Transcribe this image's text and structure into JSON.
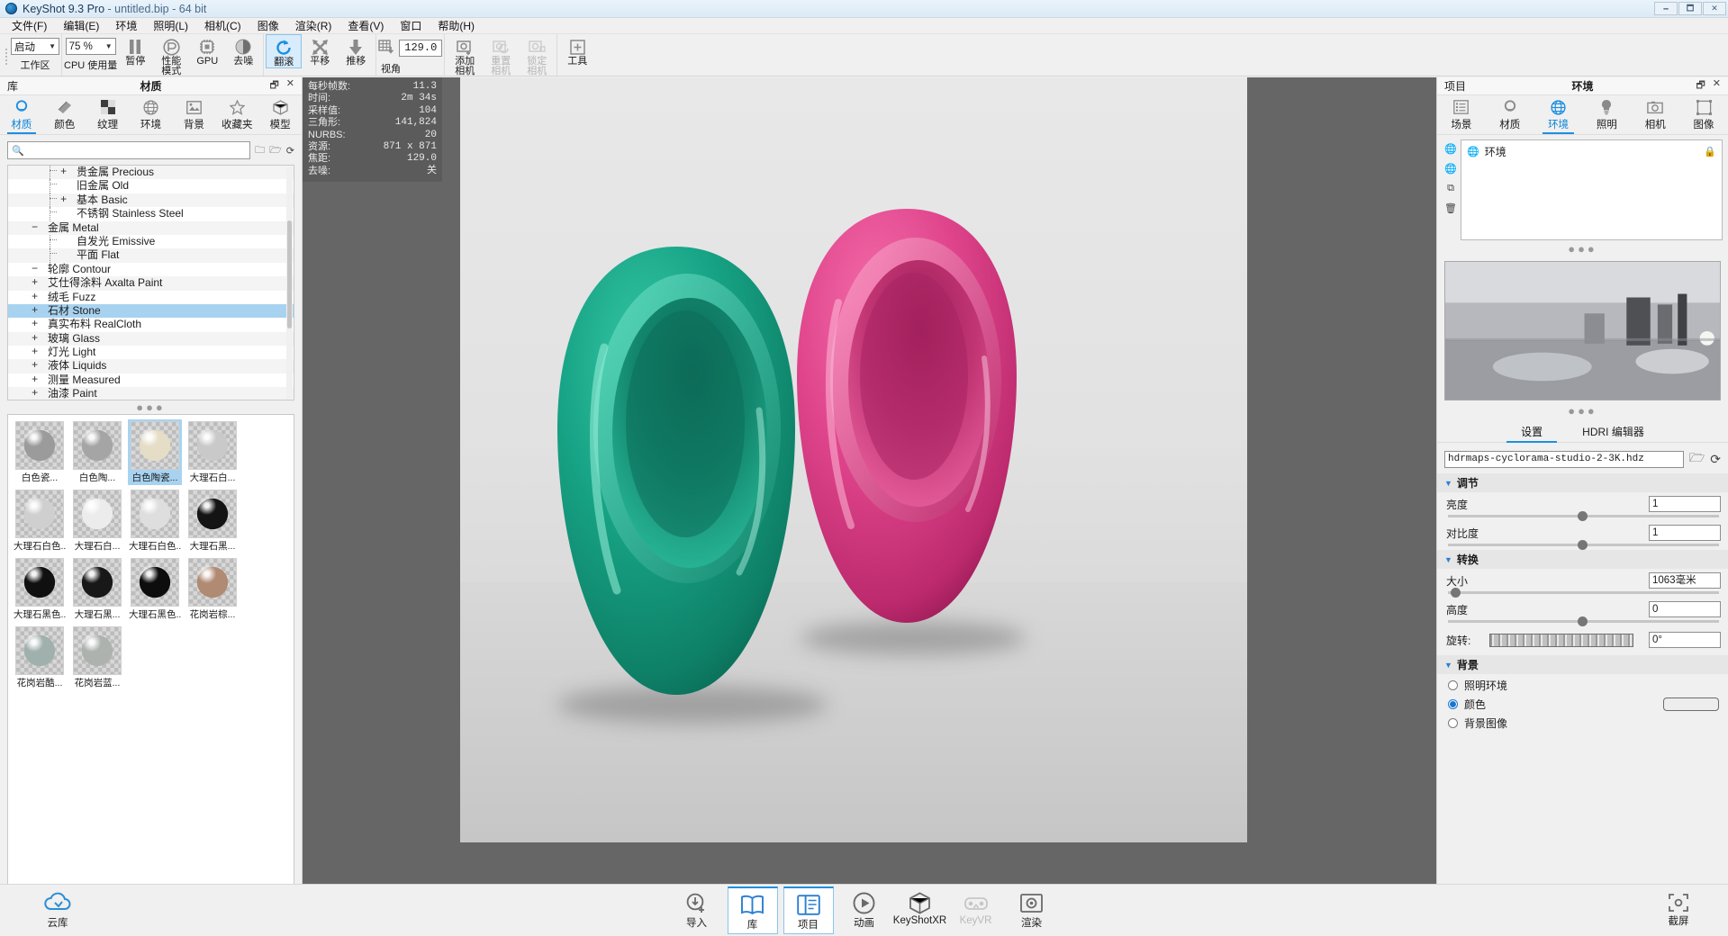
{
  "window": {
    "title_app": "KeyShot 9.3 Pro",
    "title_file": "- untitled.bip",
    "title_bits": "- 64 bit",
    "btn_minimize": "🗕",
    "btn_maximize": "🗖",
    "btn_close": "✕"
  },
  "menubar": {
    "items": [
      {
        "label": "文件(F)"
      },
      {
        "label": "编辑(E)"
      },
      {
        "label": "环境"
      },
      {
        "label": "照明(L)"
      },
      {
        "label": "相机(C)"
      },
      {
        "label": "图像"
      },
      {
        "label": "渲染(R)"
      },
      {
        "label": "查看(V)"
      },
      {
        "label": "窗口"
      },
      {
        "label": "帮助(H)"
      }
    ]
  },
  "toolbar": {
    "workspace_value": "启动",
    "workspace_label": "工作区",
    "cpu_value": "75 %",
    "cpu_label": "CPU 使用量",
    "pause_label": "暂停",
    "perf_label_1": "性能",
    "perf_label_2": "模式",
    "gpu_label": "GPU",
    "denoise_label": "去噪",
    "tumble_label": "翻滚",
    "pan_label": "平移",
    "dolly_label": "推移",
    "fov_value": "129.0",
    "fov_label": "视角",
    "addcam_label_1": "添加",
    "addcam_label_2": "相机",
    "resetcam_label_1": "重置",
    "resetcam_label_2": "相机",
    "lockcam_label_1": "锁定",
    "lockcam_label_2": "相机",
    "tools_label": "工具"
  },
  "library": {
    "panel_left_title": "库",
    "panel_center_title": "材质",
    "header_icons": {
      "float": "🗗",
      "close": "✕"
    },
    "tabs": [
      {
        "label": "材质",
        "icon": "material-icon",
        "active": true
      },
      {
        "label": "颜色",
        "icon": "color-icon",
        "active": false
      },
      {
        "label": "纹理",
        "icon": "texture-icon",
        "active": false
      },
      {
        "label": "环境",
        "icon": "environment-icon",
        "active": false
      },
      {
        "label": "背景",
        "icon": "background-icon",
        "active": false
      },
      {
        "label": "收藏夹",
        "icon": "star-icon",
        "active": false
      },
      {
        "label": "模型",
        "icon": "model-icon",
        "active": false
      }
    ],
    "search_placeholder": "",
    "search_value": "",
    "tree": [
      {
        "label": "油漆 Paint",
        "toggle": "+",
        "level": 1,
        "selected": false
      },
      {
        "label": "测量 Measured",
        "toggle": "+",
        "level": 1,
        "selected": false
      },
      {
        "label": "液体 Liquids",
        "toggle": "+",
        "level": 1,
        "selected": false
      },
      {
        "label": "灯光 Light",
        "toggle": "+",
        "level": 1,
        "selected": false
      },
      {
        "label": "玻璃 Glass",
        "toggle": "+",
        "level": 1,
        "selected": false
      },
      {
        "label": "真实布料 RealCloth",
        "toggle": "+",
        "level": 1,
        "selected": false
      },
      {
        "label": "石材 Stone",
        "toggle": "+",
        "level": 1,
        "selected": true
      },
      {
        "label": "绒毛 Fuzz",
        "toggle": "+",
        "level": 1,
        "selected": false
      },
      {
        "label": "艾仕得涂料 Axalta Paint",
        "toggle": "+",
        "level": 1,
        "selected": false
      },
      {
        "label": "轮廓 Contour",
        "toggle": "−",
        "level": 1,
        "selected": false
      },
      {
        "label": "平面 Flat",
        "toggle": "",
        "level": 2,
        "selected": false
      },
      {
        "label": "自发光 Emissive",
        "toggle": "",
        "level": 2,
        "selected": false
      },
      {
        "label": "金属 Metal",
        "toggle": "−",
        "level": 1,
        "selected": false
      },
      {
        "label": "不锈钢 Stainless Steel",
        "toggle": "",
        "level": 2,
        "selected": false
      },
      {
        "label": "基本 Basic",
        "toggle": "+",
        "level": 2,
        "selected": false
      },
      {
        "label": "旧金属 Old",
        "toggle": "",
        "level": 2,
        "selected": false
      },
      {
        "label": "贵金属 Precious",
        "toggle": "+",
        "level": 2,
        "selected": false
      }
    ],
    "materials": [
      {
        "caption": "白色瓷...",
        "color": "#9b9b9b",
        "selected": false
      },
      {
        "caption": "白色陶...",
        "color": "#a5a5a5",
        "selected": false
      },
      {
        "caption": "白色陶瓷...",
        "color": "#e6ddc7",
        "selected": true
      },
      {
        "caption": "大理石白...",
        "color": "#c9c9c9",
        "selected": false
      },
      {
        "caption": "大理石白色...",
        "color": "#cfcfcf",
        "selected": false
      },
      {
        "caption": "大理石白...",
        "color": "#ececec",
        "selected": false
      },
      {
        "caption": "大理石白色...",
        "color": "#dedede",
        "selected": false
      },
      {
        "caption": "大理石黑...",
        "color": "#141414",
        "selected": false
      },
      {
        "caption": "大理石黑色...",
        "color": "#101010",
        "selected": false
      },
      {
        "caption": "大理石黑...",
        "color": "#181818",
        "selected": false
      },
      {
        "caption": "大理石黑色...",
        "color": "#0d0d0d",
        "selected": false
      },
      {
        "caption": "花岗岩棕...",
        "color": "#b08a72",
        "selected": false
      },
      {
        "caption": "花岗岩酷...",
        "color": "#9fb0ad",
        "selected": false
      },
      {
        "caption": "花岗岩蓝...",
        "color": "#aeb2ae",
        "selected": false
      }
    ],
    "footer_icons": [
      "list-view-icon",
      "grid-view-icon",
      "zoom-icon",
      "add-folder-icon",
      "cloud-icon",
      "folder-icon"
    ]
  },
  "stats": {
    "rows": [
      {
        "key": "每秒帧数:",
        "value": "11.3"
      },
      {
        "key": "时间:",
        "value": "2m 34s"
      },
      {
        "key": "采样值:",
        "value": "104"
      },
      {
        "key": "三角形:",
        "value": "141,824"
      },
      {
        "key": "NURBS:",
        "value": "20"
      },
      {
        "key": "资源:",
        "value": "871 x 871"
      },
      {
        "key": "焦距:",
        "value": "129.0"
      },
      {
        "key": "去噪:",
        "value": "关"
      }
    ]
  },
  "scene": {
    "bowl_teal_color": "#18a184",
    "bowl_teal_dark": "#0c6f5c",
    "bowl_pink_color": "#e0458c",
    "bowl_pink_dark": "#a82363"
  },
  "project": {
    "panel_left_title": "项目",
    "panel_center_title": "环境",
    "header_icons": {
      "float": "🗗",
      "close": "✕"
    },
    "tabs": [
      {
        "label": "场景",
        "icon": "scene-icon",
        "active": false
      },
      {
        "label": "材质",
        "icon": "material-icon",
        "active": false
      },
      {
        "label": "环境",
        "icon": "environment-icon",
        "active": true
      },
      {
        "label": "照明",
        "icon": "lighting-icon",
        "active": false
      },
      {
        "label": "相机",
        "icon": "camera-icon",
        "active": false
      },
      {
        "label": "图像",
        "icon": "image-icon",
        "active": false
      }
    ],
    "side_tools": [
      "environment-icon",
      "add-environment-icon",
      "duplicate-environment-icon",
      "delete-icon"
    ],
    "env_item_label": "环境",
    "settings_tabs": [
      {
        "label": "设置",
        "active": true
      },
      {
        "label": "HDRI 编辑器",
        "active": false
      }
    ],
    "hdri_file": "hdrmaps-cyclorama-studio-2-3K.hdz",
    "sections": {
      "adjust": {
        "title": "调节",
        "rows": [
          {
            "label": "亮度",
            "value": "1",
            "slider_pct": 50
          },
          {
            "label": "对比度",
            "value": "1",
            "slider_pct": 50
          }
        ]
      },
      "transform": {
        "title": "转换",
        "size": {
          "label": "大小",
          "value": "1063毫米",
          "slider_pct": 3
        },
        "height": {
          "label": "高度",
          "value": "0",
          "slider_pct": 50
        },
        "rotation": {
          "label": "旋转:",
          "value": "0°"
        }
      },
      "background": {
        "title": "背景",
        "options": [
          {
            "label": "照明环境",
            "selected": false
          },
          {
            "label": "颜色",
            "selected": true
          },
          {
            "label": "背景图像",
            "selected": false
          }
        ],
        "color_swatch": "#ededed"
      }
    }
  },
  "bottombar": {
    "cloud_label": "云库",
    "buttons": [
      {
        "label": "导入",
        "icon": "import-icon",
        "active": false,
        "disabled": false
      },
      {
        "label": "库",
        "icon": "library-book-icon",
        "active": true,
        "disabled": false
      },
      {
        "label": "项目",
        "icon": "project-icon",
        "active": true,
        "disabled": false
      },
      {
        "label": "动画",
        "icon": "animation-play-icon",
        "active": false,
        "disabled": false
      },
      {
        "label": "KeyShotXR",
        "icon": "keyshotxr-icon",
        "active": false,
        "disabled": false
      },
      {
        "label": "KeyVR",
        "icon": "keyvr-icon",
        "active": false,
        "disabled": true
      },
      {
        "label": "渲染",
        "icon": "render-icon",
        "active": false,
        "disabled": false
      }
    ],
    "screenshot_label": "截屏"
  }
}
